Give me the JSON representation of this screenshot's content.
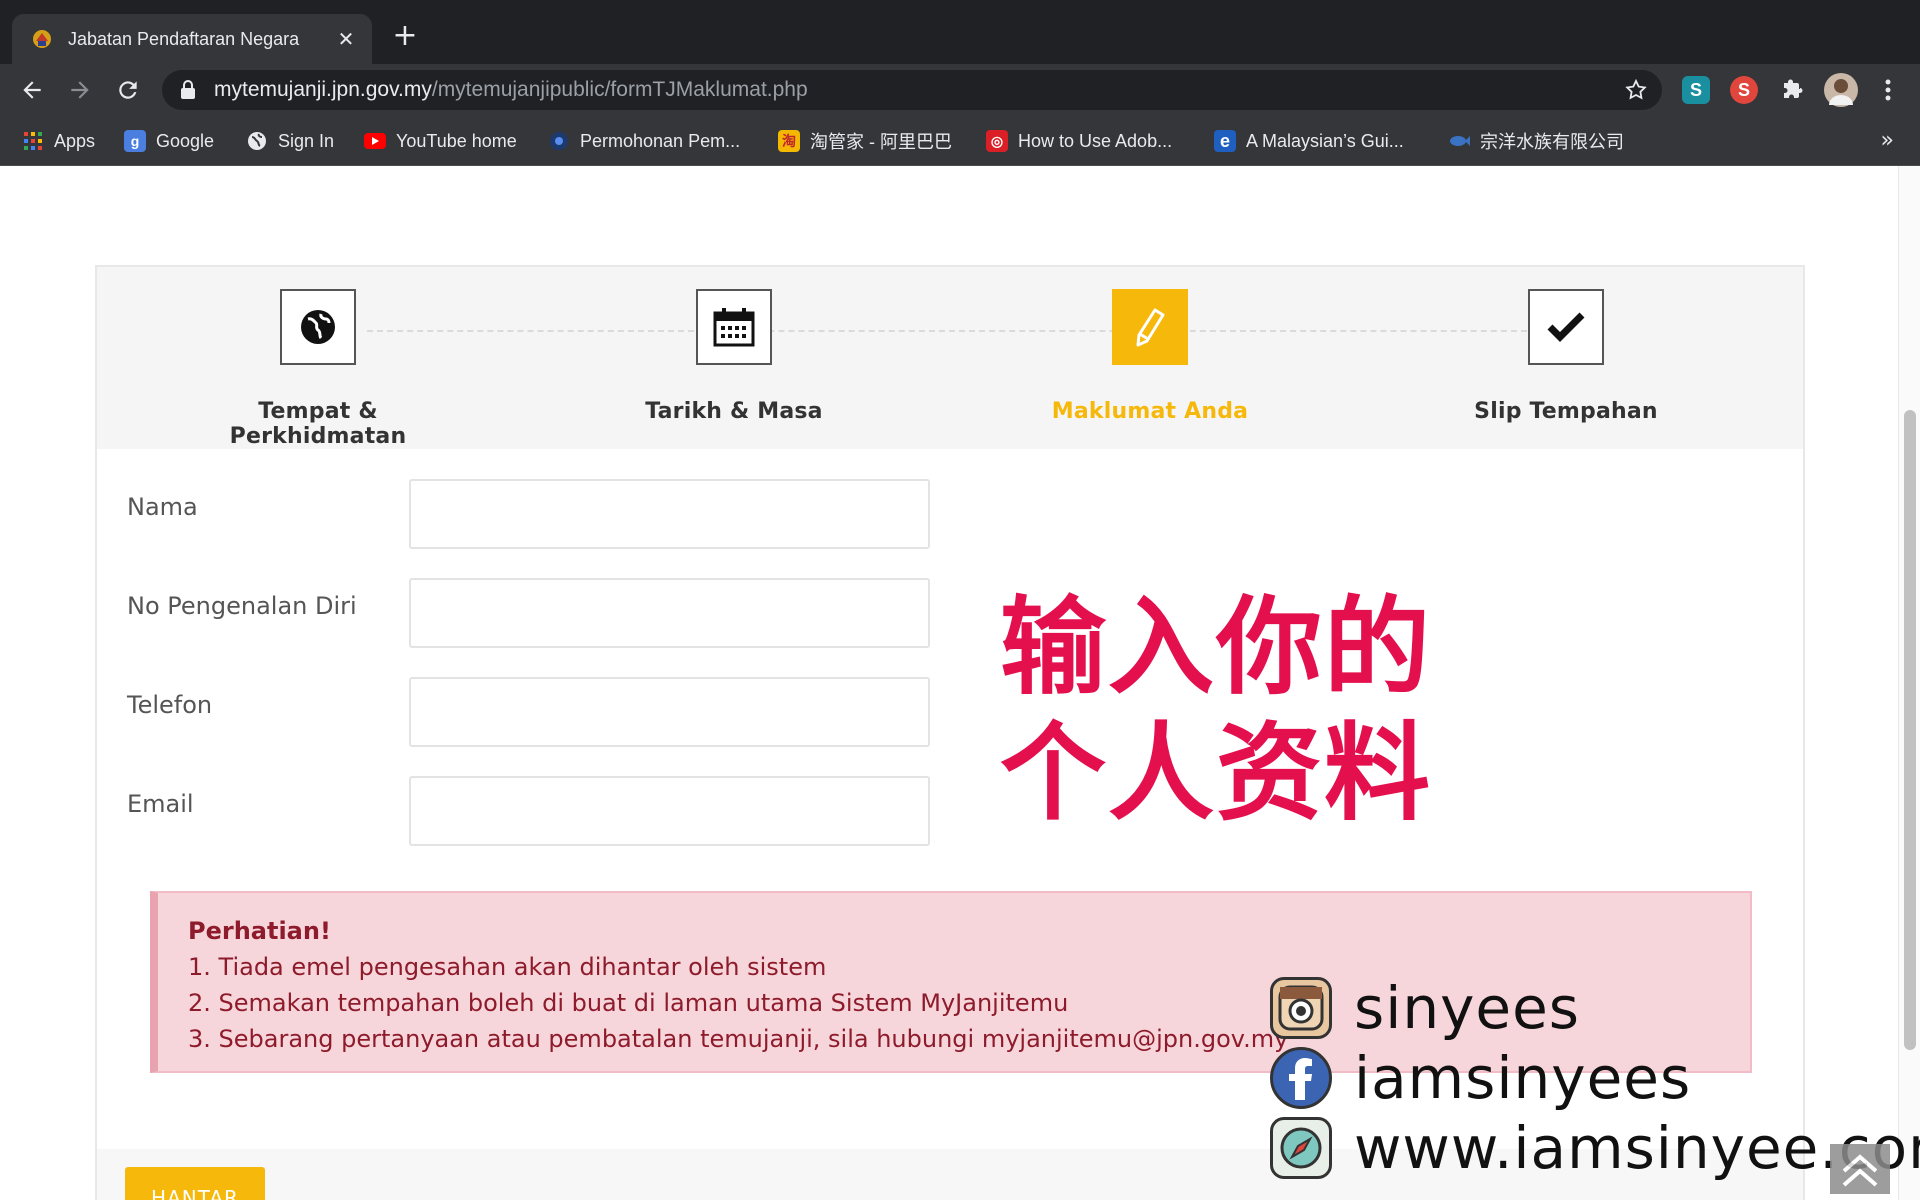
{
  "browser": {
    "tab_title": "Jabatan Pendaftaran Negara",
    "url_host": "mytemujanji.jpn.gov.my",
    "url_path": "/mytemujanjipublic/formTJMaklumat.php",
    "bookmarks": [
      {
        "label": "Apps",
        "icon": "apps-grid-icon"
      },
      {
        "label": "Google",
        "icon": "google-icon"
      },
      {
        "label": "Sign In",
        "icon": "globe-icon"
      },
      {
        "label": "YouTube home",
        "icon": "youtube-icon"
      },
      {
        "label": "Permohonan Pem...",
        "icon": "circle-dot-icon"
      },
      {
        "label": "淘管家 - 阿里巴巴",
        "icon": "taoguanjia-icon"
      },
      {
        "label": "How to Use Adob...",
        "icon": "adobe-icon"
      },
      {
        "label": "A Malaysian’s Gui...",
        "icon": "e-logo-icon"
      },
      {
        "label": "宗洋水族有限公司",
        "icon": "fish-icon"
      }
    ],
    "more_label": "»"
  },
  "steps": [
    {
      "label": "Tempat & Perkhidmatan",
      "icon": "globe-icon",
      "active": false
    },
    {
      "label": "Tarikh & Masa",
      "icon": "calendar-icon",
      "active": false
    },
    {
      "label": "Maklumat Anda",
      "icon": "pencil-icon",
      "active": true
    },
    {
      "label": "Slip Tempahan",
      "icon": "checkmark-icon",
      "active": false
    }
  ],
  "form": {
    "fields": [
      {
        "label": "Nama",
        "value": ""
      },
      {
        "label": "No Pengenalan Diri",
        "value": ""
      },
      {
        "label": "Telefon",
        "value": ""
      },
      {
        "label": "Email",
        "value": ""
      }
    ],
    "submit_label": "HANTAR"
  },
  "overlay": {
    "line1": "输入你的",
    "line2": "个人资料"
  },
  "alert": {
    "heading": "Perhatian!",
    "items": [
      "1. Tiada emel pengesahan akan dihantar oleh sistem",
      "2. Semakan tempahan boleh di buat di laman utama Sistem MyJanjitemu",
      "3. Sebarang pertanyaan atau pembatalan temujanji, sila hubungi myjanjitemu@jpn.gov.my"
    ]
  },
  "social": [
    {
      "icon": "instagram-icon",
      "text": "sinyees"
    },
    {
      "icon": "facebook-icon",
      "text": "iamsinyees"
    },
    {
      "icon": "safari-compass-icon",
      "text": "www.iamsinyee.com"
    }
  ],
  "colors": {
    "accent": "#f6b80a",
    "overlay_text": "#e4104e",
    "alert_bg": "#f7d6db",
    "alert_text": "#8e1b2b"
  }
}
